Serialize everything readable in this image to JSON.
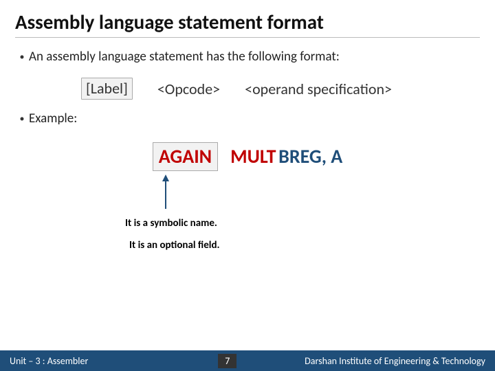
{
  "title": "Assembly language statement format",
  "bullets": {
    "intro": "An assembly language statement has the following format:",
    "example_label": "Example:"
  },
  "format": {
    "label": "[Label]",
    "opcode": "<Opcode>",
    "operand": "<operand specification>"
  },
  "example": {
    "again": "AGAIN",
    "mult": "MULT",
    "breg": "BREG, A"
  },
  "notes": {
    "line1": "It is a symbolic name.",
    "line2": "It is an optional field."
  },
  "footer": {
    "left": "Unit – 3  : Assembler",
    "page": "7",
    "right": "Darshan Institute of Engineering & Technology"
  }
}
